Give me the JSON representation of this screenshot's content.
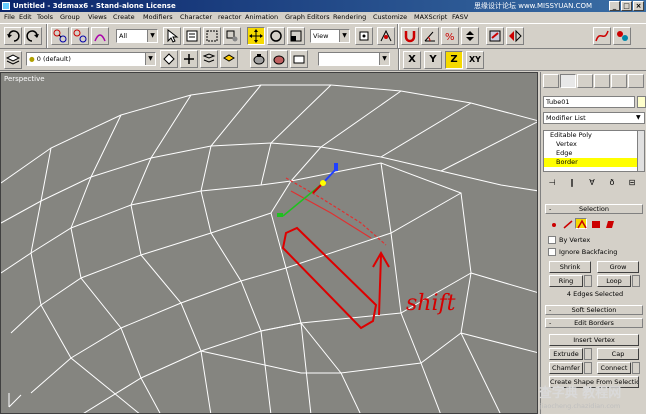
{
  "window": {
    "title": "Untitled - 3dsmax6 - Stand-alone License",
    "watermark_cn": "思缘设计论坛 www.MISSYUAN.COM",
    "buttons": [
      "_",
      "□",
      "×"
    ]
  },
  "menu": [
    "File",
    "Edit",
    "Tools",
    "Group",
    "Views",
    "Create",
    "Modifiers",
    "Character",
    "reactor",
    "Animation",
    "Graph Editors",
    "Rendering",
    "Customize",
    "MAXScript",
    "FASV"
  ],
  "main_toolbar": {
    "selection_filter": "All",
    "ref_coord": "View"
  },
  "layer_toolbar": {
    "layer_name": "0 (default)",
    "axis_buttons": [
      "X",
      "Y",
      "Z",
      "XY"
    ],
    "active_axis": "Z"
  },
  "viewport": {
    "label": "Perspective",
    "annotation": "shift",
    "colors": {
      "background": "#858580",
      "wire": "#ffffff",
      "selected": "#e03030",
      "gizmo_x": "#d00000",
      "gizmo_y": "#20c020",
      "gizmo_z": "#2040ff"
    }
  },
  "command_panel": {
    "object_name": "Tube01",
    "modifier_list": "Modifier List",
    "stack": [
      "Editable Poly",
      "Vertex",
      "Edge",
      "Border"
    ],
    "stack_selected": "Border",
    "selection_rollout": "Selection",
    "by_vertex": "By Vertex",
    "ignore_backfacing": "Ignore Backfacing",
    "shrink": "Shrink",
    "grow": "Grow",
    "ring": "Ring",
    "loop": "Loop",
    "selected_info": "4 Edges Selected",
    "soft_selection": "Soft Selection",
    "edit_borders": "Edit Borders",
    "insert_vertex": "Insert Vertex",
    "extrude": "Extrude",
    "cap": "Cap",
    "chamfer": "Chamfer",
    "connect": "Connect",
    "create_shape": "Create Shape From Selection"
  },
  "footer_watermark": {
    "title": "查字典 教程网",
    "url": "jiaocheng.chazidian.com"
  }
}
